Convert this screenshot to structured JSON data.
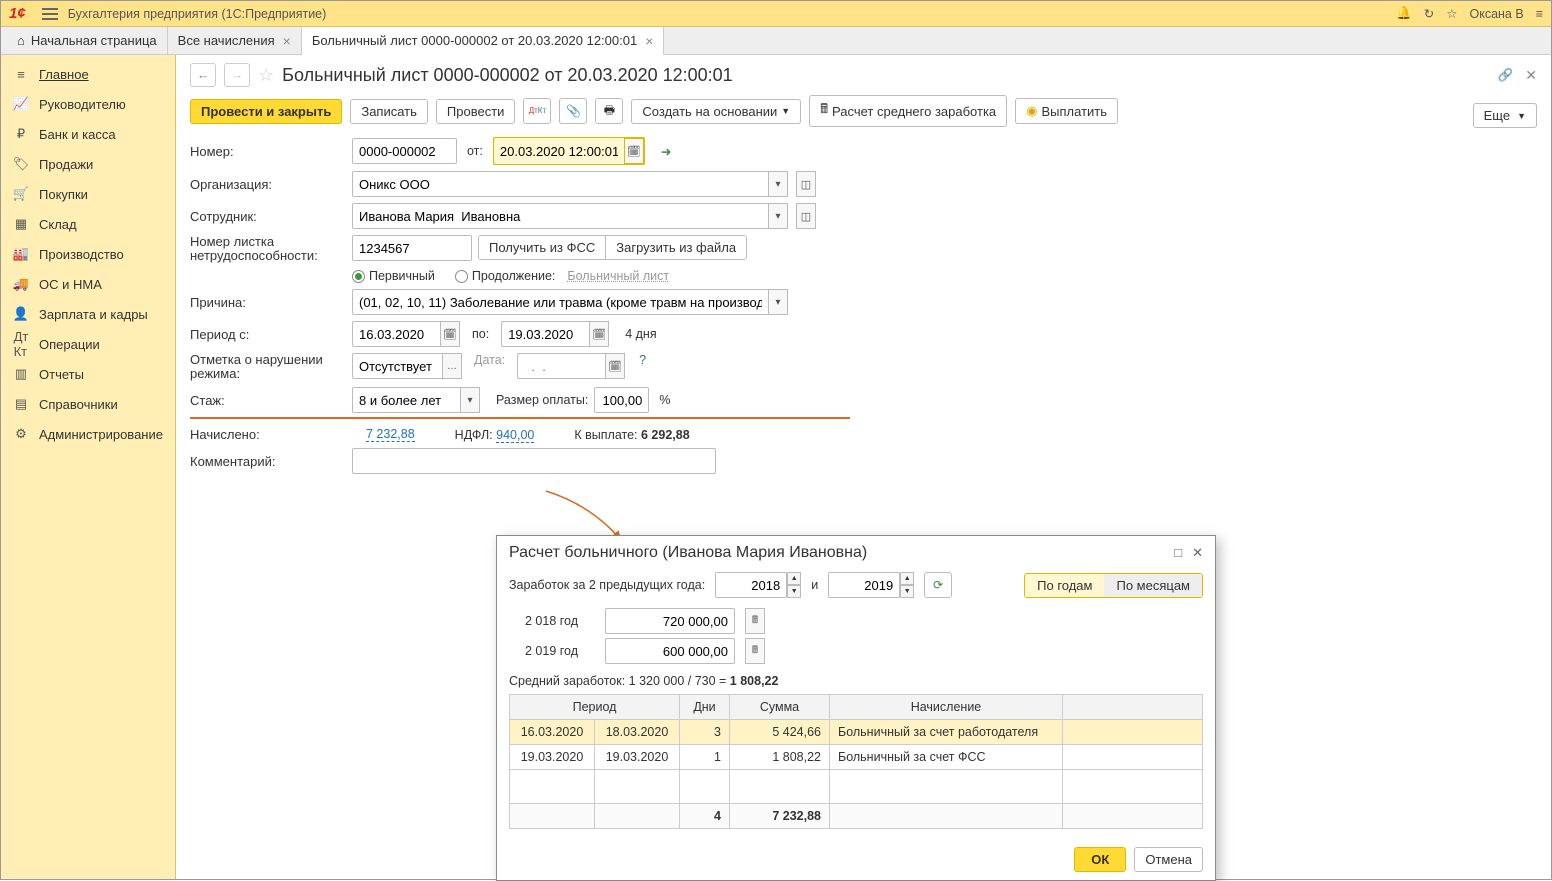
{
  "titlebar": {
    "app": "Бухгалтерия предприятия   (1С:Предприятие)",
    "user": "Оксана В"
  },
  "tabs": {
    "home": "Начальная страница",
    "t1": "Все начисления",
    "t2": "Больничный лист 0000-000002 от 20.03.2020 12:00:01"
  },
  "sidebar": {
    "items": [
      {
        "label": "Главное"
      },
      {
        "label": "Руководителю"
      },
      {
        "label": "Банк и касса"
      },
      {
        "label": "Продажи"
      },
      {
        "label": "Покупки"
      },
      {
        "label": "Склад"
      },
      {
        "label": "Производство"
      },
      {
        "label": "ОС и НМА"
      },
      {
        "label": "Зарплата и кадры"
      },
      {
        "label": "Операции"
      },
      {
        "label": "Отчеты"
      },
      {
        "label": "Справочники"
      },
      {
        "label": "Администрирование"
      }
    ]
  },
  "doc": {
    "title": "Больничный лист 0000-000002 от 20.03.2020 12:00:01",
    "toolbar": {
      "post_close": "Провести и закрыть",
      "write": "Записать",
      "post": "Провести",
      "create_based": "Создать на основании",
      "calc_avg": "Расчет среднего заработка",
      "pay": "Выплатить",
      "more": "Еще"
    },
    "fields": {
      "number_label": "Номер:",
      "number": "0000-000002",
      "from_label": "от:",
      "datetime": "20.03.2020 12:00:01",
      "org_label": "Организация:",
      "org": "Оникс ООО",
      "emp_label": "Сотрудник:",
      "emp": "Иванова Мария  Ивановна",
      "sheet_no_label": "Номер листка нетрудоспособности:",
      "sheet_no": "1234567",
      "get_fss": "Получить из ФСС",
      "load_file": "Загрузить из файла",
      "primary": "Первичный",
      "continuation": "Продолжение:",
      "cont_link": "Больничный лист",
      "reason_label": "Причина:",
      "reason": "(01, 02, 10, 11) Заболевание или травма (кроме травм на производстве)",
      "period_from_label": "Период с:",
      "period_from": "16.03.2020",
      "period_to_label": "по:",
      "period_to": "19.03.2020",
      "days": "4 дня",
      "violation_label": "Отметка о нарушении режима:",
      "violation": "Отсутствует",
      "date_label": "Дата:",
      "date_ph": "  .  .    ",
      "stage_label": "Стаж:",
      "stage": "8 и более лет",
      "pay_size_label": "Размер оплаты:",
      "pay_size": "100,00",
      "pct": "%",
      "accrued_label": "Начислено:",
      "accrued": "7 232,88",
      "ndfl_label": "НДФЛ:",
      "ndfl": "940,00",
      "to_pay_label": "К выплате:",
      "to_pay": "6 292,88",
      "comment_label": "Комментарий:"
    }
  },
  "modal": {
    "title": "Расчет больничного (Иванова Мария Ивановна)",
    "earn_label": "Заработок за 2 предыдущих года:",
    "y1": "2018",
    "and": "и",
    "y2": "2019",
    "by_year": "По годам",
    "by_month": "По месяцам",
    "row1_label": "2 018 год",
    "row1_val": "720 000,00",
    "row2_label": "2 019 год",
    "row2_val": "600 000,00",
    "avg_text": "Средний заработок: 1 320 000 / 730 = ",
    "avg_val": "1 808,22",
    "th": {
      "period": "Период",
      "days": "Дни",
      "sum": "Сумма",
      "accr": "Начисление"
    },
    "r1": {
      "d1": "16.03.2020",
      "d2": "18.03.2020",
      "days": "3",
      "sum": "5 424,66",
      "acc": "Больничный за счет работодателя"
    },
    "r2": {
      "d1": "19.03.2020",
      "d2": "19.03.2020",
      "days": "1",
      "sum": "1 808,22",
      "acc": "Больничный за счет ФСС"
    },
    "tot": {
      "days": "4",
      "sum": "7 232,88"
    },
    "ok": "ОК",
    "cancel": "Отмена"
  }
}
